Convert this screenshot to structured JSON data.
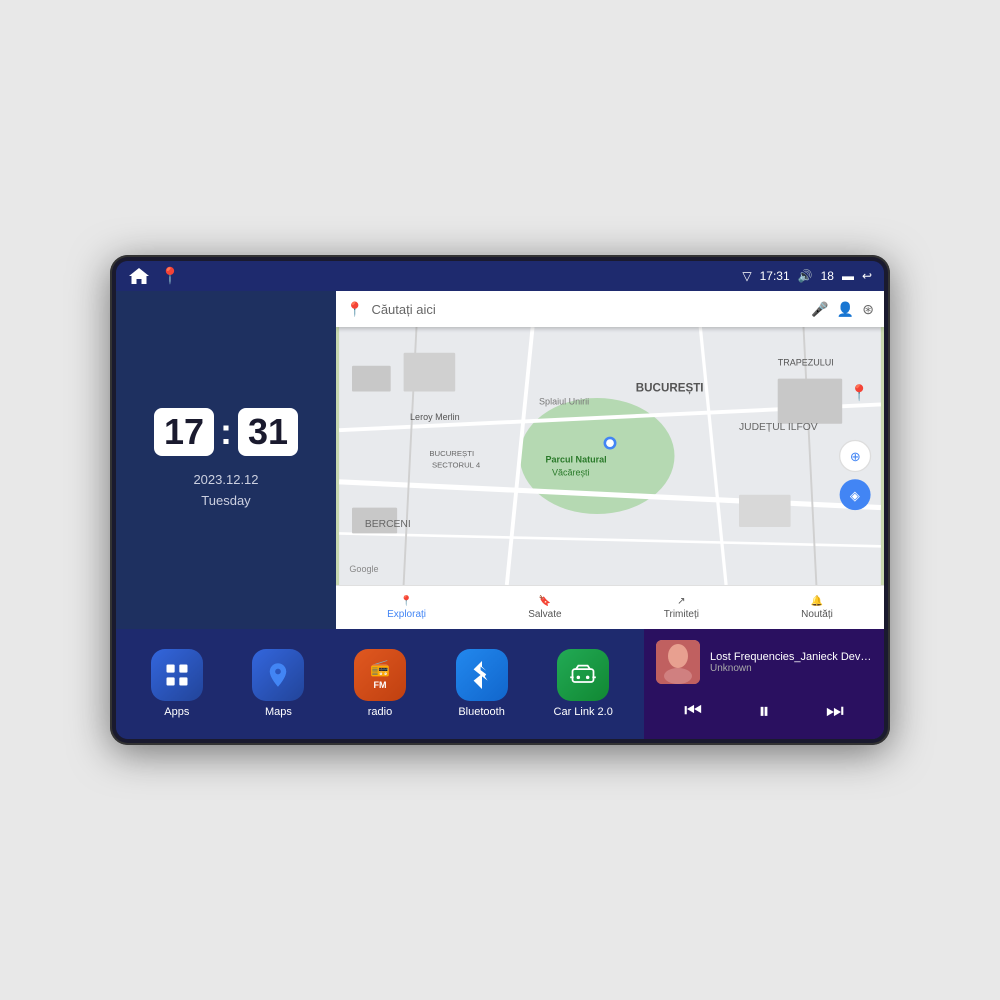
{
  "device": {
    "status_bar": {
      "left_icons": [
        "home",
        "maps-pin"
      ],
      "time": "17:31",
      "signal_icon": "signal",
      "volume_label": "18",
      "battery_icon": "battery",
      "back_icon": "back"
    },
    "clock": {
      "hour": "17",
      "minute": "31",
      "date": "2023.12.12",
      "day": "Tuesday"
    },
    "map": {
      "search_placeholder": "Căutați aici",
      "bottom_items": [
        {
          "label": "Explorați",
          "active": true
        },
        {
          "label": "Salvate",
          "active": false
        },
        {
          "label": "Trimiteți",
          "active": false
        },
        {
          "label": "Noutăți",
          "active": false
        }
      ],
      "labels": [
        "BUCUREȘTI",
        "JUDEȚUL ILFOV",
        "BERCENI",
        "TRAPEZULUI",
        "Parcul Natural Văcărești",
        "Leroy Merlin",
        "BUCUREȘTI SECTORUL 4",
        "Splaiul Unirii"
      ]
    },
    "apps": [
      {
        "name": "Apps",
        "icon": "apps",
        "color": "#2255cc"
      },
      {
        "name": "Maps",
        "icon": "maps",
        "color": "#2255cc"
      },
      {
        "name": "radio",
        "icon": "radio",
        "color": "#e05020"
      },
      {
        "name": "Bluetooth",
        "icon": "bluetooth",
        "color": "#2288ee"
      },
      {
        "name": "Car Link 2.0",
        "icon": "carlink",
        "color": "#22aa55"
      }
    ],
    "music": {
      "title": "Lost Frequencies_Janieck Devy-...",
      "artist": "Unknown",
      "controls": {
        "prev": "⏮",
        "play": "⏸",
        "next": "⏭"
      }
    }
  }
}
